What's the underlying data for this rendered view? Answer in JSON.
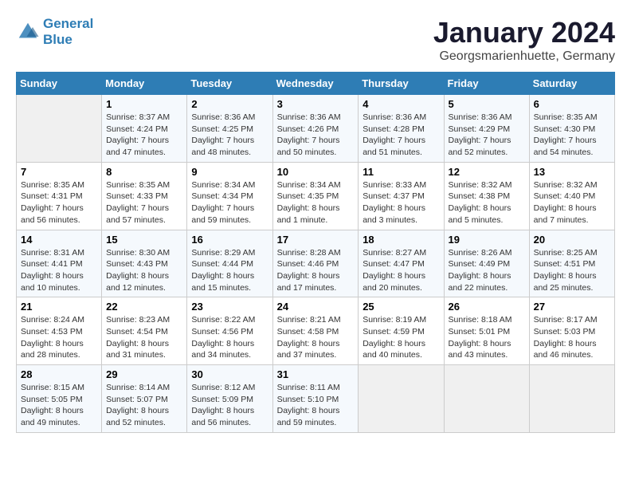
{
  "logo": {
    "line1": "General",
    "line2": "Blue"
  },
  "title": "January 2024",
  "location": "Georgsmarienhuette, Germany",
  "days_header": [
    "Sunday",
    "Monday",
    "Tuesday",
    "Wednesday",
    "Thursday",
    "Friday",
    "Saturday"
  ],
  "weeks": [
    [
      {
        "day": "",
        "info": ""
      },
      {
        "day": "1",
        "info": "Sunrise: 8:37 AM\nSunset: 4:24 PM\nDaylight: 7 hours\nand 47 minutes."
      },
      {
        "day": "2",
        "info": "Sunrise: 8:36 AM\nSunset: 4:25 PM\nDaylight: 7 hours\nand 48 minutes."
      },
      {
        "day": "3",
        "info": "Sunrise: 8:36 AM\nSunset: 4:26 PM\nDaylight: 7 hours\nand 50 minutes."
      },
      {
        "day": "4",
        "info": "Sunrise: 8:36 AM\nSunset: 4:28 PM\nDaylight: 7 hours\nand 51 minutes."
      },
      {
        "day": "5",
        "info": "Sunrise: 8:36 AM\nSunset: 4:29 PM\nDaylight: 7 hours\nand 52 minutes."
      },
      {
        "day": "6",
        "info": "Sunrise: 8:35 AM\nSunset: 4:30 PM\nDaylight: 7 hours\nand 54 minutes."
      }
    ],
    [
      {
        "day": "7",
        "info": "Sunrise: 8:35 AM\nSunset: 4:31 PM\nDaylight: 7 hours\nand 56 minutes."
      },
      {
        "day": "8",
        "info": "Sunrise: 8:35 AM\nSunset: 4:33 PM\nDaylight: 7 hours\nand 57 minutes."
      },
      {
        "day": "9",
        "info": "Sunrise: 8:34 AM\nSunset: 4:34 PM\nDaylight: 7 hours\nand 59 minutes."
      },
      {
        "day": "10",
        "info": "Sunrise: 8:34 AM\nSunset: 4:35 PM\nDaylight: 8 hours\nand 1 minute."
      },
      {
        "day": "11",
        "info": "Sunrise: 8:33 AM\nSunset: 4:37 PM\nDaylight: 8 hours\nand 3 minutes."
      },
      {
        "day": "12",
        "info": "Sunrise: 8:32 AM\nSunset: 4:38 PM\nDaylight: 8 hours\nand 5 minutes."
      },
      {
        "day": "13",
        "info": "Sunrise: 8:32 AM\nSunset: 4:40 PM\nDaylight: 8 hours\nand 7 minutes."
      }
    ],
    [
      {
        "day": "14",
        "info": "Sunrise: 8:31 AM\nSunset: 4:41 PM\nDaylight: 8 hours\nand 10 minutes."
      },
      {
        "day": "15",
        "info": "Sunrise: 8:30 AM\nSunset: 4:43 PM\nDaylight: 8 hours\nand 12 minutes."
      },
      {
        "day": "16",
        "info": "Sunrise: 8:29 AM\nSunset: 4:44 PM\nDaylight: 8 hours\nand 15 minutes."
      },
      {
        "day": "17",
        "info": "Sunrise: 8:28 AM\nSunset: 4:46 PM\nDaylight: 8 hours\nand 17 minutes."
      },
      {
        "day": "18",
        "info": "Sunrise: 8:27 AM\nSunset: 4:47 PM\nDaylight: 8 hours\nand 20 minutes."
      },
      {
        "day": "19",
        "info": "Sunrise: 8:26 AM\nSunset: 4:49 PM\nDaylight: 8 hours\nand 22 minutes."
      },
      {
        "day": "20",
        "info": "Sunrise: 8:25 AM\nSunset: 4:51 PM\nDaylight: 8 hours\nand 25 minutes."
      }
    ],
    [
      {
        "day": "21",
        "info": "Sunrise: 8:24 AM\nSunset: 4:53 PM\nDaylight: 8 hours\nand 28 minutes."
      },
      {
        "day": "22",
        "info": "Sunrise: 8:23 AM\nSunset: 4:54 PM\nDaylight: 8 hours\nand 31 minutes."
      },
      {
        "day": "23",
        "info": "Sunrise: 8:22 AM\nSunset: 4:56 PM\nDaylight: 8 hours\nand 34 minutes."
      },
      {
        "day": "24",
        "info": "Sunrise: 8:21 AM\nSunset: 4:58 PM\nDaylight: 8 hours\nand 37 minutes."
      },
      {
        "day": "25",
        "info": "Sunrise: 8:19 AM\nSunset: 4:59 PM\nDaylight: 8 hours\nand 40 minutes."
      },
      {
        "day": "26",
        "info": "Sunrise: 8:18 AM\nSunset: 5:01 PM\nDaylight: 8 hours\nand 43 minutes."
      },
      {
        "day": "27",
        "info": "Sunrise: 8:17 AM\nSunset: 5:03 PM\nDaylight: 8 hours\nand 46 minutes."
      }
    ],
    [
      {
        "day": "28",
        "info": "Sunrise: 8:15 AM\nSunset: 5:05 PM\nDaylight: 8 hours\nand 49 minutes."
      },
      {
        "day": "29",
        "info": "Sunrise: 8:14 AM\nSunset: 5:07 PM\nDaylight: 8 hours\nand 52 minutes."
      },
      {
        "day": "30",
        "info": "Sunrise: 8:12 AM\nSunset: 5:09 PM\nDaylight: 8 hours\nand 56 minutes."
      },
      {
        "day": "31",
        "info": "Sunrise: 8:11 AM\nSunset: 5:10 PM\nDaylight: 8 hours\nand 59 minutes."
      },
      {
        "day": "",
        "info": ""
      },
      {
        "day": "",
        "info": ""
      },
      {
        "day": "",
        "info": ""
      }
    ]
  ]
}
